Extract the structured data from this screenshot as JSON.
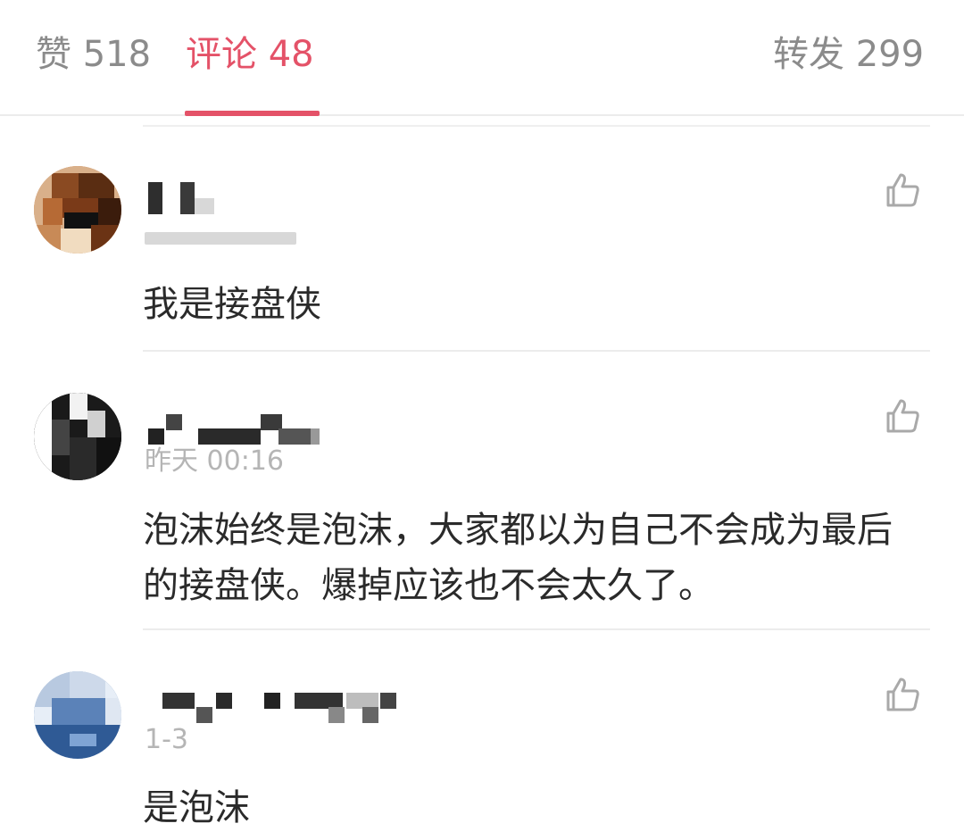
{
  "tabs": {
    "likes": "赞 518",
    "comments": "评论 48",
    "reposts": "转发 299"
  },
  "accent_color": "#e45268",
  "comments": [
    {
      "time": "",
      "text": "我是接盘侠",
      "like_icon": "thumbs-up-outline"
    },
    {
      "time": "昨天 00:16",
      "text": "泡沫始终是泡沫，大家都以为自己不会成为最后的接盘侠。爆掉应该也不会太久了。",
      "like_icon": "thumbs-up-outline"
    },
    {
      "time": "1-3",
      "text": "是泡沫",
      "like_icon": "thumbs-up-outline"
    }
  ]
}
